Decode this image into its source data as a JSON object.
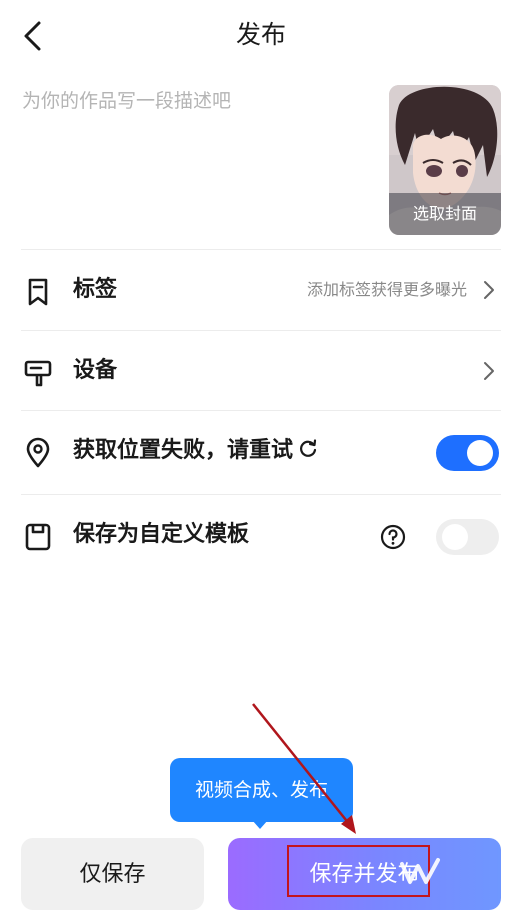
{
  "header": {
    "title": "发布",
    "back_icon": "chevron-left-icon"
  },
  "description": {
    "placeholder": "为你的作品写一段描述吧",
    "value": ""
  },
  "cover": {
    "label": "选取封面"
  },
  "rows": [
    {
      "key": "tags",
      "icon": "bookmark-icon",
      "label": "标签",
      "hint": "添加标签获得更多曝光",
      "has_chevron": true
    },
    {
      "key": "device",
      "icon": "device-icon",
      "label": "设备",
      "hint": "",
      "has_chevron": true
    },
    {
      "key": "location",
      "icon": "location-pin-icon",
      "label": "获取位置失败，请重试",
      "trailing_icon": "refresh-icon",
      "toggle_on": true
    },
    {
      "key": "template",
      "icon": "save-icon",
      "label": "保存为自定义模板",
      "trailing_icon": "help-icon",
      "toggle_on": false
    }
  ],
  "tooltip": {
    "text": "视频合成、发布"
  },
  "footer": {
    "save_only_label": "仅保存",
    "save_publish_label": "保存并发布"
  },
  "colors": {
    "accent": "#1e6fff",
    "tooltip": "#1f86ff",
    "gradient_start": "#9b6bff",
    "gradient_end": "#6f97ff",
    "annotation": "#c3151c"
  }
}
